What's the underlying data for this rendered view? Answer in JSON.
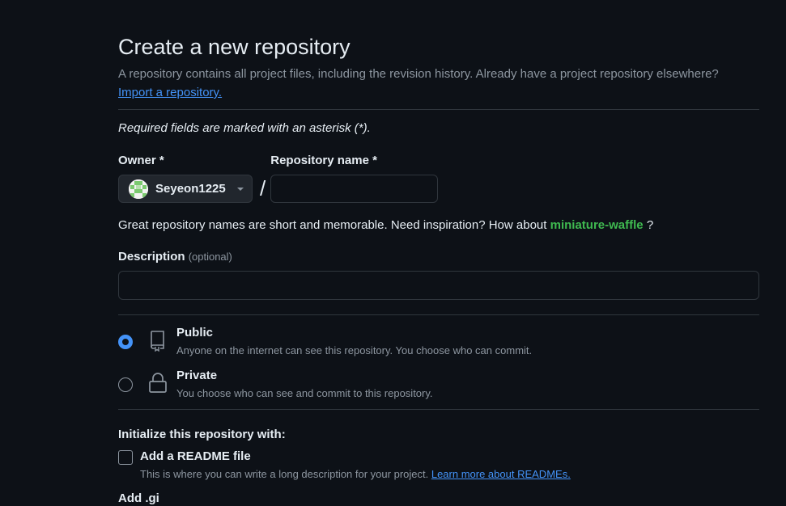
{
  "header": {
    "title": "Create a new repository",
    "subtitle": "A repository contains all project files, including the revision history. Already have a project repository elsewhere?",
    "import_link": "Import a repository."
  },
  "required_note": "Required fields are marked with an asterisk (*).",
  "owner": {
    "label": "Owner *",
    "value": "Seyeon1225"
  },
  "separator": "/",
  "repo_name": {
    "label": "Repository name *",
    "value": "",
    "placeholder": ""
  },
  "inspiration": {
    "text": "Great repository names are short and memorable. Need inspiration? How about",
    "suggestion": "miniature-waffle",
    "suffix": "?"
  },
  "description": {
    "label": "Description",
    "optional": "(optional)",
    "value": "",
    "placeholder": ""
  },
  "visibility": {
    "selected": "public",
    "options": [
      {
        "id": "public",
        "title": "Public",
        "description": "Anyone on the internet can see this repository. You choose who can commit.",
        "icon": "repo-icon"
      },
      {
        "id": "private",
        "title": "Private",
        "description": "You choose who can see and commit to this repository.",
        "icon": "lock-icon"
      }
    ]
  },
  "initialize": {
    "title": "Initialize this repository with:",
    "readme": {
      "label": "Add a README file",
      "checked": false,
      "description": "This is where you can write a long description for your project.",
      "learn_more": "Learn more about READMEs."
    }
  },
  "next_section_partial": "Add .gi",
  "colors": {
    "background": "#0d1117",
    "border": "#30363d",
    "text": "#e6edf3",
    "muted": "#8d96a0",
    "accent": "#4493f8",
    "suggestion": "#3fb950"
  }
}
